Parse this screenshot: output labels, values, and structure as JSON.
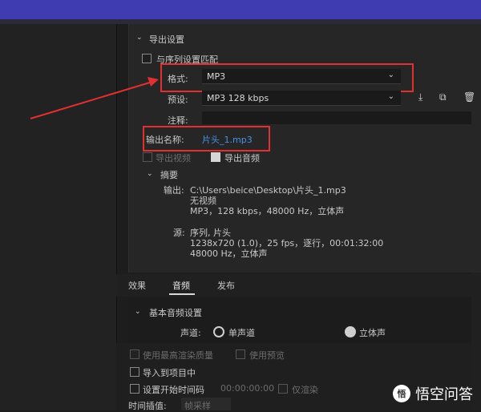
{
  "export_settings": {
    "section_title": "导出设置",
    "match_sequence_label": "与序列设置匹配",
    "format_label": "格式:",
    "format_value": "MP3",
    "preset_label": "预设:",
    "preset_value": "MP3 128 kbps",
    "comment_label": "注释:",
    "output_name_label": "输出名称:",
    "output_name_value": "片头_1.mp3",
    "export_video_label": "导出视频",
    "export_audio_label": "导出音频"
  },
  "summary": {
    "title": "摘要",
    "output_label": "输出:",
    "output_path": "C:\\Users\\beice\\Desktop\\片头_1.mp3",
    "output_line2": "无视频",
    "output_line3": "MP3，128 kbps，48000 Hz，立体声",
    "source_label": "源:",
    "source_line1": "序列, 片头",
    "source_line2": "1238x720 (1.0)，25 fps，逐行，00:01:32:00",
    "source_line3": "48000 Hz，立体声"
  },
  "tabs": [
    "效果",
    "音频",
    "发布"
  ],
  "active_tab": "音频",
  "basic_audio": {
    "title": "基本音频设置",
    "channel_label": "声道:",
    "mono_label": "单声道",
    "stereo_label": "立体声"
  },
  "bottom_options": {
    "max_quality": "使用最高渲染质量",
    "use_preview": "使用预览",
    "import_into_project": "导入到项目中",
    "set_start_timecode": "设置开始时间码",
    "start_timecode_value": "00:00:00:00",
    "render_label": "仅渲染",
    "time_interp_label": "时间插值:",
    "time_interp_value": "帧采样"
  },
  "watermark": {
    "text": "悟空问答",
    "badge": "悟"
  },
  "colors": {
    "highlight": "#e0302f",
    "link": "#4a90e2",
    "top_bar": "#3f3bb0"
  }
}
